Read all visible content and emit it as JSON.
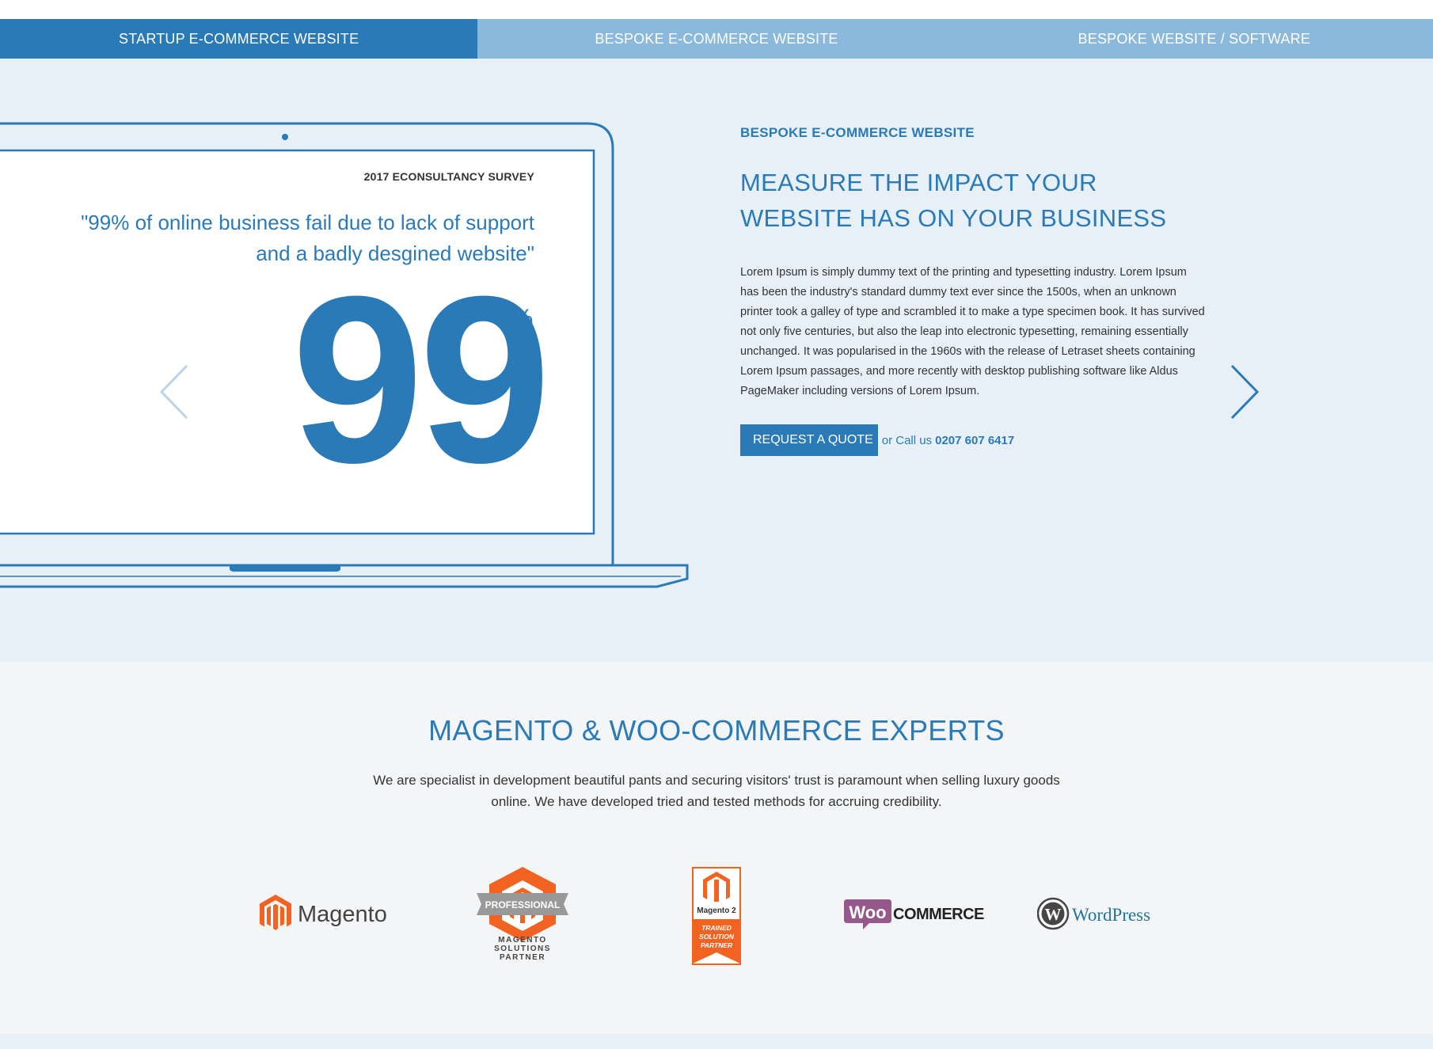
{
  "tabs": [
    {
      "label": "STARTUP E-COMMERCE WEBSITE",
      "active": true
    },
    {
      "label": "BESPOKE E-COMMERCE WEBSITE",
      "active": false
    },
    {
      "label": "BESPOKE WEBSITE / SOFTWARE",
      "active": false
    }
  ],
  "hero": {
    "survey_label": "2017 ECONSULTANCY SURVEY",
    "quote": "\"99% of online business fail due to lack of support and a badly desgined website\"",
    "stat_number": "99",
    "stat_unit": "%",
    "eyebrow": "BESPOKE E-COMMERCE WEBSITE",
    "headline": "MEASURE THE IMPACT YOUR WEBSITE HAS ON YOUR BUSINESS",
    "body": "Lorem Ipsum is simply dummy text of the printing and typesetting industry. Lorem Ipsum has been the industry's standard dummy text ever since the 1500s, when an unknown printer took a galley of type and scrambled it to make a type specimen book. It has survived not only five centuries, but also the leap into electronic typesetting, remaining essentially unchanged. It was popularised in the 1960s with the release of Letraset sheets containing Lorem Ipsum passages, and more recently with desktop publishing software like Aldus PageMaker including versions of Lorem Ipsum.",
    "cta_label": "REQUEST A QUOTE",
    "call_text": "or Call us",
    "phone": "0207 607 6417"
  },
  "experts": {
    "title": "MAGENTO & WOO-COMMERCE EXPERTS",
    "description": "We are specialist in development beautiful pants and securing visitors' trust is paramount when selling luxury goods online. We have developed tried and tested methods for accruing credibility.",
    "logos": [
      {
        "name": "magento-logo",
        "text": "Magento"
      },
      {
        "name": "magento-professional-partner-logo",
        "text": "PROFESSIONAL",
        "sub1": "MAGENTO",
        "sub2": "SOLUTIONS",
        "sub3": "PARTNER"
      },
      {
        "name": "magento2-trained-partner-logo",
        "text": "Magento 2",
        "sub1": "TRAINED",
        "sub2": "SOLUTION",
        "sub3": "PARTNER"
      },
      {
        "name": "woocommerce-logo",
        "text_woo": "Woo",
        "text_commerce": "COMMERCE"
      },
      {
        "name": "wordpress-logo",
        "text": "WordPress"
      }
    ]
  },
  "colors": {
    "primary": "#2a7ab8",
    "tab_inactive": "#8ab9dc",
    "hero_bg": "#e8f0f7",
    "experts_bg": "#f3f5f7",
    "magento_orange": "#f26322",
    "woo_purple": "#96588a"
  }
}
